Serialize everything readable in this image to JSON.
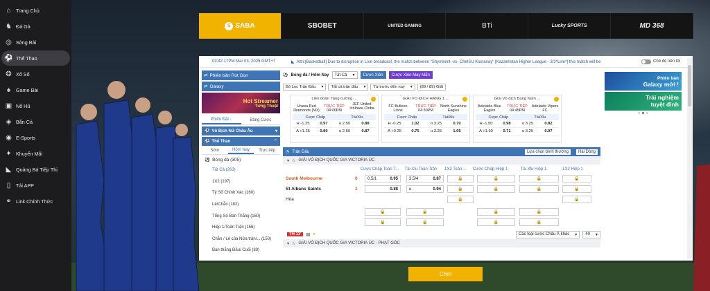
{
  "colors": {
    "accent": "#f2b300",
    "blue": "#3f74b5",
    "live": "#d33333",
    "sidebar": "#1c1c1e"
  },
  "sidebar": {
    "items": [
      {
        "label": "Trang Chủ",
        "icon": "home-icon"
      },
      {
        "label": "Đá Gà",
        "icon": "rooster-icon"
      },
      {
        "label": "Sòng Bài",
        "icon": "casino-chip-icon"
      },
      {
        "label": "Thể Thao",
        "icon": "soccer-ball-icon",
        "active": true
      },
      {
        "label": "Xổ Số",
        "icon": "lottery-icon"
      },
      {
        "label": "Game Bài",
        "icon": "cards-icon"
      },
      {
        "label": "Nổ Hũ",
        "icon": "slot-icon"
      },
      {
        "label": "Bắn Cá",
        "icon": "fish-icon"
      },
      {
        "label": "E-Sports",
        "icon": "gamepad-icon"
      },
      {
        "label": "Khuyến Mãi",
        "icon": "gift-icon"
      },
      {
        "label": "Quảng Bá Tiếp Thị",
        "icon": "megaphone-icon"
      },
      {
        "label": "Tải APP",
        "icon": "phone-icon"
      },
      {
        "label": "Link Chính Thức",
        "icon": "link-icon"
      }
    ]
  },
  "providers": [
    "SABA",
    "SBOBET",
    "UNITED GAMING",
    "BTi",
    "Lucky SPORTS",
    "MD 368"
  ],
  "topbar": {
    "time": "03:42:17PM Mar 03, 2025 GMT+7",
    "announcement": "Attn:[Basketball] Due to disruption in Live broadcast, the match between \"Shymkent -vs- ChelSU Kostanay\" [Kazakhstan Higher League - 3/3*Live*] this match will be",
    "toggle": "Chế độ nền tối"
  },
  "left": {
    "btn1": "Phiên bản Rút Gọn",
    "btn2": "Galaxy",
    "banner1": "Hot Streamer",
    "banner2": "Tưng Thuật",
    "tabs": [
      "Phiếu Đặt...",
      "Bảng Cược"
    ],
    "sec1": "Vô Địch Nữ Châu Âu",
    "sec2": "Thể Thao",
    "tabs2": [
      "Sớm",
      "Hôm Nay",
      "Trực tiếp"
    ],
    "sport": "Bóng đá (305)",
    "subs": [
      "Tất Cả (263)",
      "1X2 (197)",
      "Tỷ Số Chính Xác (160)",
      "Lẻ/Chẵn (182)",
      "Tổng Số Bàn Thắng (160)",
      "Hiệp 1/Toàn Trận (156)",
      "Chẵn / Lẻ của Nửa trận/... (150)",
      "Bàn thắng Đầu/ Cuối (89)"
    ]
  },
  "mid": {
    "sport_sel": "Bóng đá / Hôm Nay",
    "all_sel": "Tất Cả",
    "btn_parlay": "Cược Xiên",
    "btn_lucky": "Cược Xiên May Mắn",
    "filter1": "Bộ Lọc Trận Đấu",
    "filter2": "Tất cả trận đấu",
    "filter3": "Từ trước đến nay",
    "count": "(89 / 89) Giải",
    "cards": [
      {
        "league": "Liên đoàn Tăng cường ...",
        "home": "Urawa Red Diamonds (Nữ)",
        "away": "JEF United Ichihara Chiba ...",
        "status": "TRỰC TIẾP",
        "time": "04:00PM",
        "h": "H -1.25",
        "hv": "0.97",
        "o": "o 2.50",
        "ov": "0.88",
        "a": "A +1.25",
        "av": "0.80",
        "u": "u 2.50",
        "uv": "0.87"
      },
      {
        "league": "GIẢI VÔ ĐỊCH HẠNG 1 ...",
        "home": "FC Bulleen Lions",
        "away": "North Sunshine Eagles",
        "status": "TRỰC TIẾP",
        "time": "04:30PM",
        "h": "H -0.25",
        "hv": "1.02",
        "o": "o 3.25",
        "ov": "0.70",
        "a": "A +0.25",
        "av": "0.75",
        "u": "u 3.25",
        "uv": "1.05"
      },
      {
        "league": "Giải Vô địch Bang Nam ...",
        "home": "Adelaide Blue Eagles",
        "away": "Adelaide Vipers FC",
        "status": "TRỰC TIẾP",
        "time": "04:45PM",
        "h": "H -1.50",
        "hv": "0.98",
        "o": "o 3.25",
        "ov": "0.82",
        "a": "A +1.50",
        "av": "0.71",
        "u": "u 3.25",
        "uv": "0.97"
      }
    ],
    "odds_hdr1": "Cược Chấp",
    "odds_hdr2": "Tài/Xỉu",
    "table": {
      "title": "Trận Đấu",
      "view": "Lựa chọn bình thường",
      "sort": "Hai Dòng"
    },
    "league1": "GIẢI VÔ ĐỊCH QUỐC GIA VICTORIA ÚC",
    "markets": [
      "Cược Chấp Toàn T...",
      "Tài Xỉu Toàn Trận",
      "1X2 Toàn ...",
      "Cược Chấp Hiệp 1",
      "Tài Xỉu Hiệp 1",
      "1X2 Hiệp 1"
    ],
    "home": "South Melbourne",
    "away": "St Albans Saints",
    "draw": "Hòa",
    "hs": "0",
    "as": "1",
    "o1": "0.5/1",
    "o1v": "0.95",
    "o2": "3.5/4",
    "o2v": "0.87",
    "o3v": "0.88",
    "o4": "u",
    "o4v": "0.94",
    "live": "TH 11'",
    "more": "Các loại cược Châu Á khác",
    "per": "40",
    "league2": "GIẢI VÔ ĐỊCH QUỐC GIA VICTORIA ÚC - PHẠT GÓC"
  },
  "right": {
    "b1a": "Phiên bản",
    "b1b": "Galaxy mới !",
    "b2a": "Trải nghiệm",
    "b2b": "tuyệt đỉnh"
  },
  "play": "Chơi"
}
